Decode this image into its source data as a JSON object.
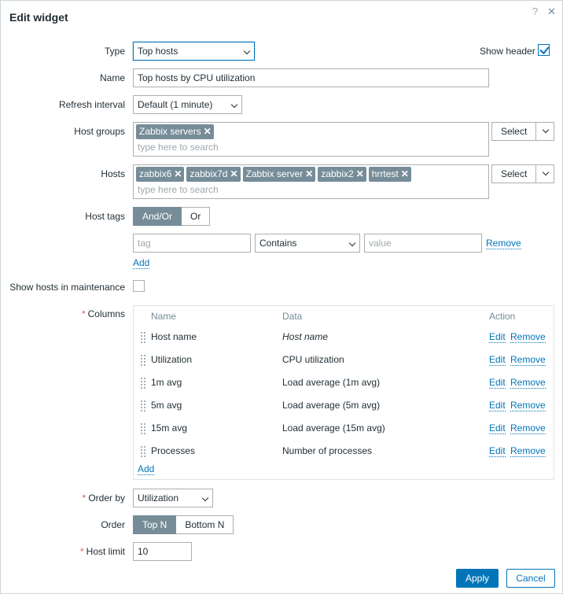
{
  "dialog": {
    "title": "Edit widget",
    "help_icon": "?",
    "close_icon": "✕"
  },
  "type": {
    "label": "Type",
    "value": "Top hosts"
  },
  "show_header": {
    "label": "Show header",
    "checked": true
  },
  "name": {
    "label": "Name",
    "value": "Top hosts by CPU utilization"
  },
  "refresh": {
    "label": "Refresh interval",
    "value": "Default (1 minute)"
  },
  "host_groups": {
    "label": "Host groups",
    "chips": [
      "Zabbix servers"
    ],
    "placeholder": "type here to search",
    "select_label": "Select"
  },
  "hosts": {
    "label": "Hosts",
    "chips": [
      "zabbix6",
      "zabbix7d",
      "Zabbix server",
      "zabbix2",
      "hrrtest"
    ],
    "placeholder": "type here to search",
    "select_label": "Select"
  },
  "host_tags": {
    "label": "Host tags",
    "options": [
      "And/Or",
      "Or"
    ],
    "selected": "And/Or",
    "tag_placeholder": "tag",
    "operator": "Contains",
    "value_placeholder": "value",
    "remove_label": "Remove",
    "add_label": "Add"
  },
  "maintenance": {
    "label": "Show hosts in maintenance",
    "checked": false
  },
  "columns": {
    "label": "Columns",
    "headers": {
      "name": "Name",
      "data": "Data",
      "action": "Action"
    },
    "rows": [
      {
        "name": "Host name",
        "data": "Host name",
        "italic": true
      },
      {
        "name": "Utilization",
        "data": "CPU utilization"
      },
      {
        "name": "1m avg",
        "data": "Load average (1m avg)"
      },
      {
        "name": "5m avg",
        "data": "Load average (5m avg)"
      },
      {
        "name": "15m avg",
        "data": "Load average (15m avg)"
      },
      {
        "name": "Processes",
        "data": "Number of processes"
      }
    ],
    "edit_label": "Edit",
    "remove_label": "Remove",
    "add_label": "Add"
  },
  "order_by": {
    "label": "Order by",
    "value": "Utilization"
  },
  "order": {
    "label": "Order",
    "options": [
      "Top N",
      "Bottom N"
    ],
    "selected": "Top N"
  },
  "host_limit": {
    "label": "Host limit",
    "value": "10"
  },
  "buttons": {
    "apply": "Apply",
    "cancel": "Cancel"
  },
  "colors": {
    "accent": "#0275b8",
    "chip": "#768d99",
    "required": "#e45959"
  }
}
